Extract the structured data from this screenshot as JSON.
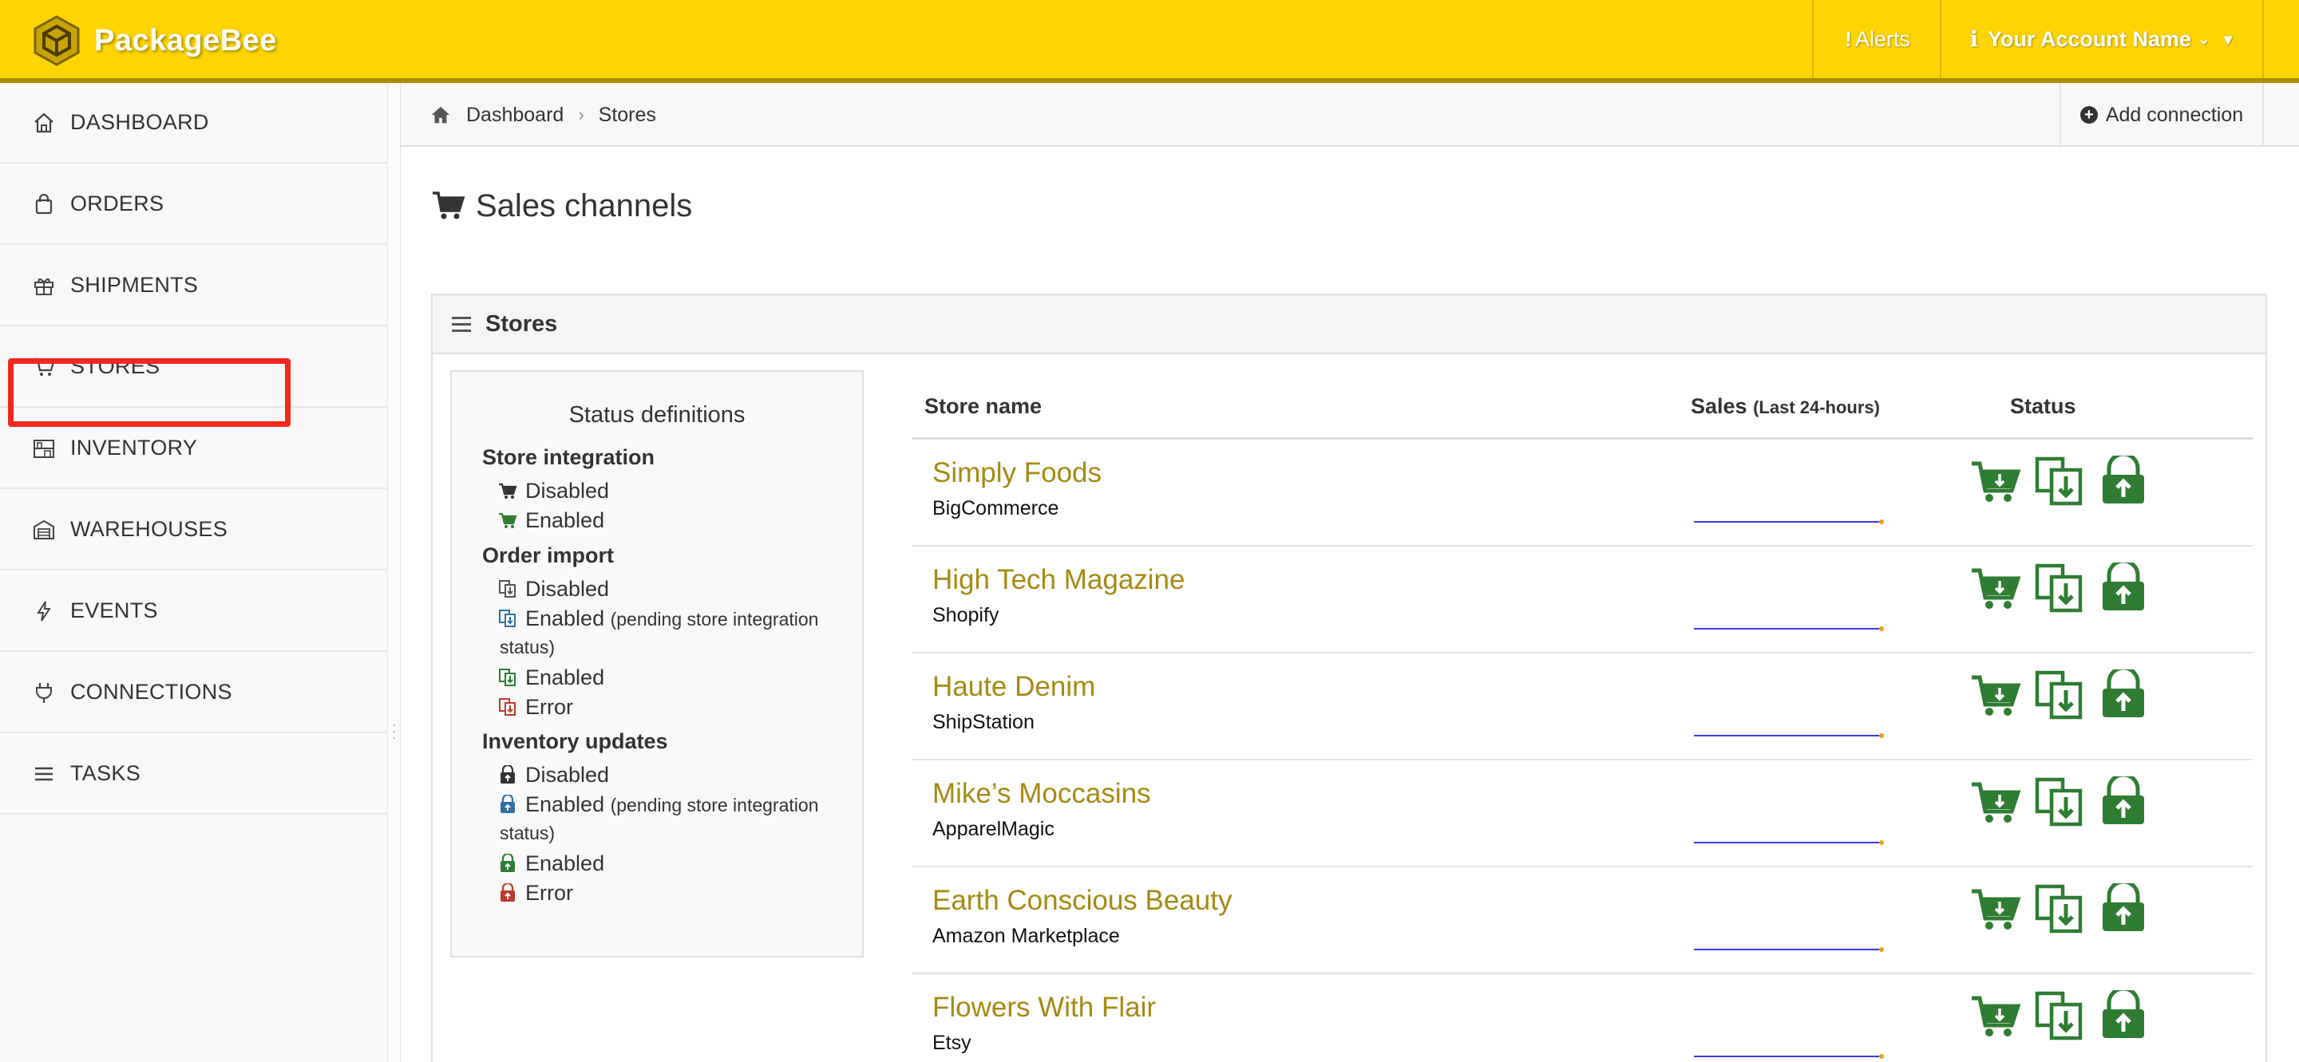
{
  "brand": {
    "name": "PackageBee"
  },
  "topbar": {
    "alerts_label": "Alerts",
    "account_label": "Your Account Name"
  },
  "sidebar": {
    "items": [
      {
        "key": "dashboard",
        "label": "DASHBOARD",
        "icon": "home-icon"
      },
      {
        "key": "orders",
        "label": "ORDERS",
        "icon": "shopping-bag-icon"
      },
      {
        "key": "shipments",
        "label": "SHIPMENTS",
        "icon": "gift-icon"
      },
      {
        "key": "stores",
        "label": "STORES",
        "icon": "cart-icon"
      },
      {
        "key": "inventory",
        "label": "INVENTORY",
        "icon": "shelves-icon"
      },
      {
        "key": "warehouses",
        "label": "WAREHOUSES",
        "icon": "warehouse-icon"
      },
      {
        "key": "events",
        "label": "EVENTS",
        "icon": "bolt-icon"
      },
      {
        "key": "connections",
        "label": "CONNECTIONS",
        "icon": "plug-icon"
      },
      {
        "key": "tasks",
        "label": "TASKS",
        "icon": "bars-icon"
      }
    ]
  },
  "breadcrumb": {
    "home": "Dashboard",
    "current": "Stores"
  },
  "actions": {
    "add_connection": "Add connection"
  },
  "page": {
    "title": "Sales channels"
  },
  "panel": {
    "title": "Stores"
  },
  "definitions": {
    "title": "Status definitions",
    "store_integration": {
      "label": "Store integration",
      "disabled": "Disabled",
      "enabled": "Enabled"
    },
    "order_import": {
      "label": "Order import",
      "disabled": "Disabled",
      "enabled_pending": "Enabled",
      "pending_note": "(pending store integration",
      "pending_note2": "status)",
      "enabled": "Enabled",
      "error": "Error"
    },
    "inventory_updates": {
      "label": "Inventory updates",
      "disabled": "Disabled",
      "enabled_pending": "Enabled",
      "pending_note": "(pending store integration",
      "pending_note2": "status)",
      "enabled": "Enabled",
      "error": "Error"
    }
  },
  "table": {
    "headers": {
      "name": "Store name",
      "sales": "Sales",
      "sales_note": "(Last 24-hours)",
      "status": "Status"
    },
    "rows": [
      {
        "name": "Simply Foods",
        "platform": "BigCommerce"
      },
      {
        "name": "High Tech Magazine",
        "platform": "Shopify"
      },
      {
        "name": "Haute Denim",
        "platform": "ShipStation"
      },
      {
        "name": "Mike’s Moccasins",
        "platform": "ApparelMagic"
      },
      {
        "name": "Earth Conscious Beauty",
        "platform": "Amazon Marketplace"
      },
      {
        "name": "Flowers With Flair",
        "platform": "Etsy"
      }
    ]
  },
  "colors": {
    "topbar": "#fed402",
    "accent_link": "#a58a12",
    "status_enabled": "#2e7d32",
    "status_pending": "#2f6fa7",
    "status_error": "#c0392b",
    "highlight": "#f4281c"
  }
}
